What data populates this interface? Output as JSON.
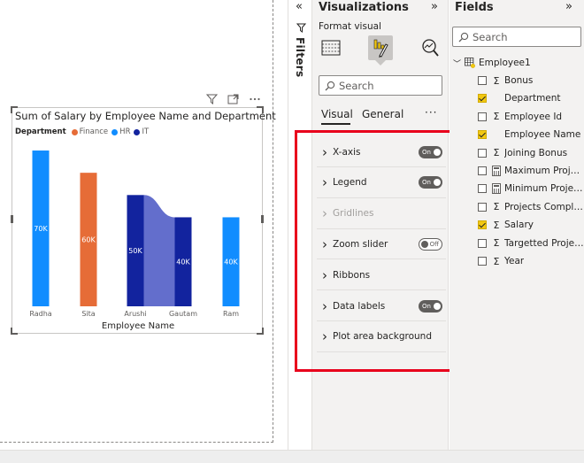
{
  "filters": {
    "label": "Filters"
  },
  "visualizations": {
    "title": "Visualizations",
    "format_visual_label": "Format visual",
    "search_placeholder": "Search",
    "tabs": [
      {
        "label": "Visual",
        "active": true
      },
      {
        "label": "General",
        "active": false
      }
    ],
    "more_label": "···",
    "sections": [
      {
        "label": "X-axis",
        "toggle": "On",
        "disabled": false
      },
      {
        "label": "Legend",
        "toggle": "On",
        "disabled": false
      },
      {
        "label": "Gridlines",
        "toggle": null,
        "disabled": true
      },
      {
        "label": "Zoom slider",
        "toggle": "Off",
        "disabled": false
      },
      {
        "label": "Ribbons",
        "toggle": null,
        "disabled": false
      },
      {
        "label": "Data labels",
        "toggle": "On",
        "disabled": false
      },
      {
        "label": "Plot area background",
        "toggle": null,
        "disabled": false
      }
    ],
    "highlight_color": "#e8001c"
  },
  "fields": {
    "title": "Fields",
    "search_placeholder": "Search",
    "table_name": "Employee1",
    "items": [
      {
        "name": "Bonus",
        "type": "sigma",
        "checked": false
      },
      {
        "name": "Department",
        "type": "text",
        "checked": true
      },
      {
        "name": "Employee Id",
        "type": "sigma",
        "checked": false
      },
      {
        "name": "Employee Name",
        "type": "text",
        "checked": true
      },
      {
        "name": "Joining Bonus",
        "type": "sigma",
        "checked": false
      },
      {
        "name": "Maximum Projects",
        "type": "calc",
        "checked": false
      },
      {
        "name": "Minimum Projects",
        "type": "calc",
        "checked": false
      },
      {
        "name": "Projects Complet...",
        "type": "sigma",
        "checked": false
      },
      {
        "name": "Salary",
        "type": "sigma",
        "checked": true
      },
      {
        "name": "Targetted Projects",
        "type": "sigma",
        "checked": false
      },
      {
        "name": "Year",
        "type": "sigma",
        "checked": false
      }
    ]
  },
  "chart_data": {
    "type": "bar",
    "title": "Sum of Salary by Employee Name and Department",
    "xlabel": "Employee Name",
    "legend": {
      "title": "Department",
      "placement": "top-left",
      "entries": [
        {
          "name": "Finance",
          "color": "#e66c37"
        },
        {
          "name": "HR",
          "color": "#118dff"
        },
        {
          "name": "IT",
          "color": "#12239e"
        }
      ]
    },
    "categories": [
      "Radha",
      "Sita",
      "Arushi",
      "Gautam",
      "Ram"
    ],
    "bars": [
      {
        "category": "Radha",
        "department": "HR",
        "value": 70000,
        "label": "70K"
      },
      {
        "category": "Sita",
        "department": "Finance",
        "value": 60000,
        "label": "60K"
      },
      {
        "category": "Arushi",
        "department": "IT",
        "value": 50000,
        "label": "50K"
      },
      {
        "category": "Gautam",
        "department": "IT",
        "value": 40000,
        "label": "40K"
      },
      {
        "category": "Ram",
        "department": "HR",
        "value": 40000,
        "label": "40K"
      }
    ],
    "ribbon": {
      "from": "Arushi",
      "to": "Gautam",
      "department": "IT",
      "color": "#5b66c9"
    },
    "ylim": [
      0,
      72000
    ],
    "grid": false
  }
}
